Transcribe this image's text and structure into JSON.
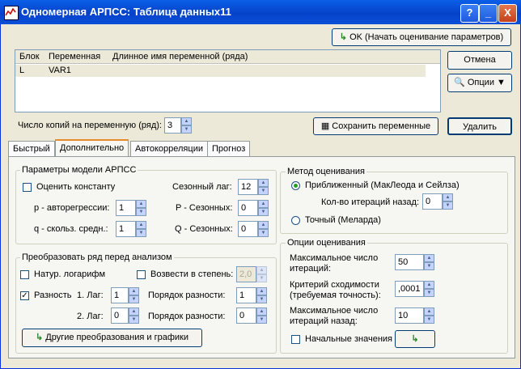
{
  "window": {
    "title": "Одномерная АРПСС: Таблица данных11",
    "help_btn": "?",
    "min_btn": "_",
    "close_btn": "X"
  },
  "buttons": {
    "ok": "OK (Начать оценивание параметров)",
    "cancel": "Отмена",
    "options": "Опции ▼",
    "save": "Сохранить переменные",
    "delete": "Удалить",
    "other_transforms": "Другие преобразования и графики"
  },
  "table": {
    "headers": [
      "Блок",
      "Переменная",
      "Длинное имя переменной (ряда)"
    ],
    "rows": [
      {
        "block": "L",
        "variable": "VAR1",
        "long_name": ""
      }
    ]
  },
  "copies": {
    "label": "Число копий на переменную (ряд):",
    "value": "3"
  },
  "tabs": [
    "Быстрый",
    "Дополнительно",
    "Автокорреляции",
    "Прогноз"
  ],
  "model_params": {
    "title": "Параметры модели АРПСС",
    "estimate_const": "Оценить константу",
    "seasonal_lag_label": "Сезонный лаг:",
    "seasonal_lag": "12",
    "p_label": "p - авторегрессии:",
    "p": "1",
    "P_label": "P - Сезонных:",
    "P": "0",
    "q_label": "q - скольз. средн.:",
    "q": "1",
    "Q_label": "Q - Сезонных:",
    "Q": "0"
  },
  "transform": {
    "title": "Преобразовать ряд перед анализом",
    "natlog": "Натур. логарифм",
    "power": "Возвести в степень:",
    "power_value": "2,0",
    "diff": "Разность",
    "lag1_label": "1. Лаг:",
    "lag1": "1",
    "order1_label": "Порядок разности:",
    "order1": "1",
    "lag2_label": "2. Лаг:",
    "lag2": "0",
    "order2_label": "Порядок разности:",
    "order2": "0"
  },
  "method": {
    "title": "Метод оценивания",
    "approx": "Приближенный (МакЛеода и Сейлза)",
    "iter_back_label": "Кол-во итераций назад:",
    "iter_back": "0",
    "exact": "Точный (Меларда)"
  },
  "est_options": {
    "title": "Опции оценивания",
    "max_iter_label1": "Максимальное число",
    "max_iter_label2": "итераций:",
    "max_iter": "50",
    "criterion_label1": "Критерий сходимости",
    "criterion_label2": "(требуемая точность):",
    "criterion": ",0001",
    "max_back_label1": "Максимальное число",
    "max_back_label2": "итераций назад:",
    "max_back": "10",
    "initial_values": "Начальные значения"
  }
}
